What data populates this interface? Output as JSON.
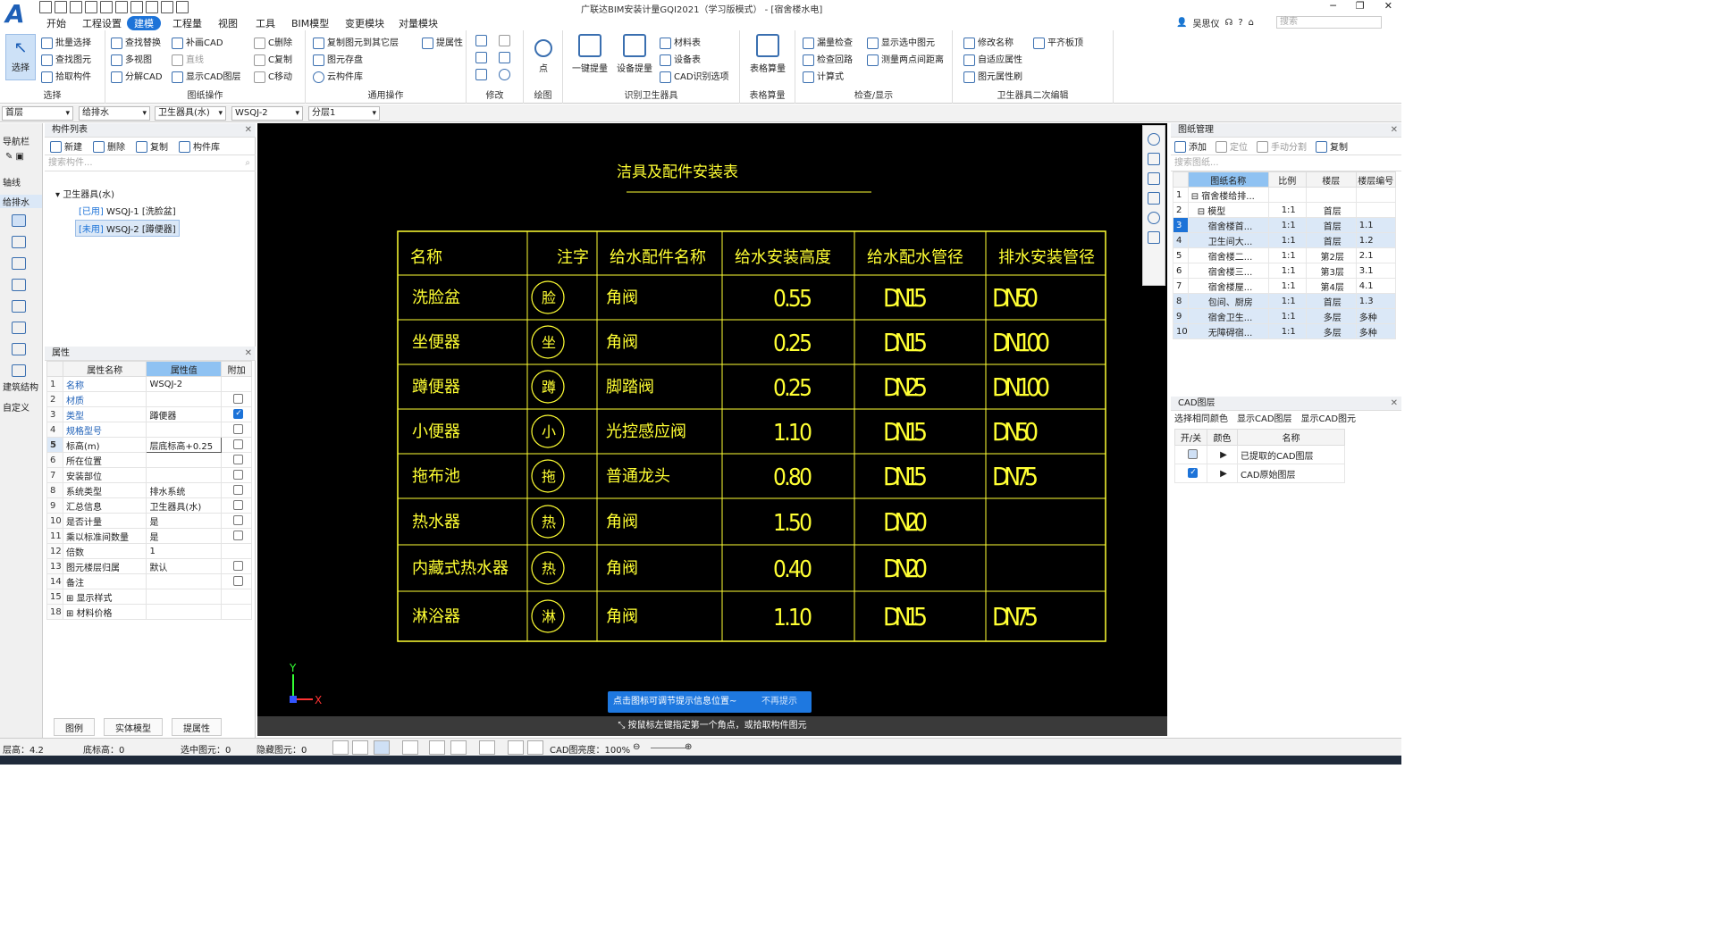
{
  "app": {
    "window_title": "广联达BIM安装计量GQI2021（学习版模式） - [宿舍楼水电]",
    "user": "吴思仪",
    "search_placeholder": "搜索"
  },
  "menu": [
    "开始",
    "工程设置",
    "建模",
    "工程量",
    "视图",
    "工具",
    "BIM模型",
    "变更模块",
    "对量模块"
  ],
  "ribbon": {
    "select": {
      "big": "选择",
      "items": [
        "批量选择",
        "查找图元",
        "拾取构件"
      ],
      "label": "选择"
    },
    "drawop": {
      "items": [
        "查找替换",
        "补画CAD",
        "C删除",
        "多视图",
        "直线",
        "C复制",
        "分解CAD",
        "显示CAD图层",
        "C移动"
      ],
      "label": "图纸操作"
    },
    "general": {
      "items": [
        "复制图元到其它层",
        "提属性",
        "图元存盘",
        "云构件库"
      ],
      "label": "通用操作"
    },
    "modify": {
      "label": "修改"
    },
    "draw": {
      "big": "点",
      "label": "绘图"
    },
    "identify": {
      "big1": "一键提量",
      "big2": "设备提量",
      "items": [
        "材料表",
        "设备表",
        "CAD识别选项"
      ],
      "label": "识别卫生器具"
    },
    "table": {
      "big": "表格算量",
      "label": "表格算量"
    },
    "check": {
      "items": [
        "漏量检查",
        "显示选中图元",
        "检查回路",
        "测量两点间距离",
        "计算式"
      ],
      "label": "检查/显示"
    },
    "edit2": {
      "items": [
        "修改名称",
        "平齐板顶",
        "自适应属性",
        "图元属性刷"
      ],
      "label": "卫生器具二次编辑"
    }
  },
  "filters": [
    "首层",
    "给排水",
    "卫生器具(水)",
    "WSQJ-2",
    "分层1"
  ],
  "nav": {
    "title": "导航栏",
    "items": [
      "轴线",
      "给排水",
      "建筑结构",
      "自定义"
    ]
  },
  "complist": {
    "title": "构件列表",
    "toolbar": [
      "新建",
      "删除",
      "复制",
      "构件库"
    ],
    "search_placeholder": "搜索构件...",
    "root": "卫生器具(水)",
    "items": [
      {
        "tag": "[已用]",
        "name": "WSQJ-1 [洗脸盆]"
      },
      {
        "tag": "[未用]",
        "name": "WSQJ-2 [蹲便器]"
      }
    ]
  },
  "props": {
    "title": "属性",
    "headers": [
      "属性名称",
      "属性值",
      "附加"
    ],
    "rows": [
      {
        "n": "1",
        "name": "名称",
        "val": "WSQJ-2",
        "cb": null
      },
      {
        "n": "2",
        "name": "材质",
        "val": "",
        "cb": false
      },
      {
        "n": "3",
        "name": "类型",
        "val": "蹲便器",
        "cb": true
      },
      {
        "n": "4",
        "name": "规格型号",
        "val": "",
        "cb": false
      },
      {
        "n": "5",
        "name": "标高(m)",
        "val": "层底标高+0.25",
        "cb": false
      },
      {
        "n": "6",
        "name": "所在位置",
        "val": "",
        "cb": false
      },
      {
        "n": "7",
        "name": "安装部位",
        "val": "",
        "cb": false
      },
      {
        "n": "8",
        "name": "系统类型",
        "val": "排水系统",
        "cb": false
      },
      {
        "n": "9",
        "name": "汇总信息",
        "val": "卫生器具(水)",
        "cb": false
      },
      {
        "n": "10",
        "name": "是否计量",
        "val": "是",
        "cb": false
      },
      {
        "n": "11",
        "name": "乘以标准间数量",
        "val": "是",
        "cb": false
      },
      {
        "n": "12",
        "name": "倍数",
        "val": "1",
        "cb": null
      },
      {
        "n": "13",
        "name": "图元楼层归属",
        "val": "默认",
        "cb": false
      },
      {
        "n": "14",
        "name": "备注",
        "val": "",
        "cb": false
      },
      {
        "n": "15",
        "name": "显示样式",
        "val": "",
        "cb": null
      },
      {
        "n": "18",
        "name": "材料价格",
        "val": "",
        "cb": null
      }
    ]
  },
  "leftbottom": [
    "图例",
    "实体模型",
    "提属性"
  ],
  "cad": {
    "title": "洁具及配件安装表",
    "headers": [
      "名称",
      "注字",
      "给水配件名称",
      "给水安装高度",
      "给水配水管径",
      "排水安装管径"
    ],
    "rows": [
      [
        "洗脸盆",
        "脸",
        "角阀",
        "0.55",
        "DN15",
        "DN50"
      ],
      [
        "坐便器",
        "坐",
        "角阀",
        "0.25",
        "DN15",
        "DN100"
      ],
      [
        "蹲便器",
        "蹲",
        "脚踏阀",
        "0.25",
        "DN25",
        "DN100"
      ],
      [
        "小便器",
        "小",
        "光控感应阀",
        "1.10",
        "DN15",
        "DN50"
      ],
      [
        "拖布池",
        "拖",
        "普通龙头",
        "0.80",
        "DN15",
        "DN75"
      ],
      [
        "热水器",
        "热",
        "角阀",
        "1.50",
        "DN20",
        ""
      ],
      [
        "内藏式热水器",
        "热",
        "角阀",
        "0.40",
        "DN20",
        ""
      ],
      [
        "淋浴器",
        "淋",
        "角阀",
        "1.10",
        "DN15",
        "DN75"
      ]
    ],
    "axis_y": "Y",
    "axis_x": "X"
  },
  "hint": {
    "text": "点击图标可调节提示信息位置~",
    "dismiss": "不再提示"
  },
  "cmdline": "按鼠标左键指定第一个角点，或拾取构件图元",
  "drawings": {
    "title": "图纸管理",
    "toolbar": [
      "添加",
      "定位",
      "手动分割",
      "复制"
    ],
    "search_placeholder": "搜索图纸...",
    "headers": [
      "图纸名称",
      "比例",
      "楼层",
      "楼层编号"
    ],
    "rows": [
      {
        "n": "1",
        "name": "宿舍楼给排...",
        "scale": "",
        "floor": "",
        "code": "",
        "hl": false
      },
      {
        "n": "2",
        "name": "模型",
        "scale": "1:1",
        "floor": "首层",
        "code": "",
        "hl": false
      },
      {
        "n": "3",
        "name": "宿舍楼首...",
        "scale": "1:1",
        "floor": "首层",
        "code": "1.1",
        "hl": true
      },
      {
        "n": "4",
        "name": "卫生间大...",
        "scale": "1:1",
        "floor": "首层",
        "code": "1.2",
        "hl": true
      },
      {
        "n": "5",
        "name": "宿舍楼二...",
        "scale": "1:1",
        "floor": "第2层",
        "code": "2.1",
        "hl": false
      },
      {
        "n": "6",
        "name": "宿舍楼三...",
        "scale": "1:1",
        "floor": "第3层",
        "code": "3.1",
        "hl": false
      },
      {
        "n": "7",
        "name": "宿舍楼屋...",
        "scale": "1:1",
        "floor": "第4层",
        "code": "4.1",
        "hl": false
      },
      {
        "n": "8",
        "name": "包间、厨房",
        "scale": "1:1",
        "floor": "首层",
        "code": "1.3",
        "hl": true
      },
      {
        "n": "9",
        "name": "宿舍卫生...",
        "scale": "1:1",
        "floor": "多层",
        "code": "多种",
        "hl": true
      },
      {
        "n": "10",
        "name": "无障碍宿...",
        "scale": "1:1",
        "floor": "多层",
        "code": "多种",
        "hl": true
      }
    ]
  },
  "cadlayer": {
    "title": "CAD图层",
    "toolbar": [
      "选择相同颜色",
      "显示CAD图层",
      "显示CAD图元"
    ],
    "headers": [
      "开/关",
      "颜色",
      "名称"
    ],
    "rows": [
      "已提取的CAD图层",
      "CAD原始图层"
    ]
  },
  "status": {
    "floor_height": "层高：4.2",
    "bottom_elev": "底标高：0",
    "selected": "选中图元：0",
    "hidden": "隐藏图元：0",
    "cad_brightness": "CAD图亮度：100%"
  }
}
